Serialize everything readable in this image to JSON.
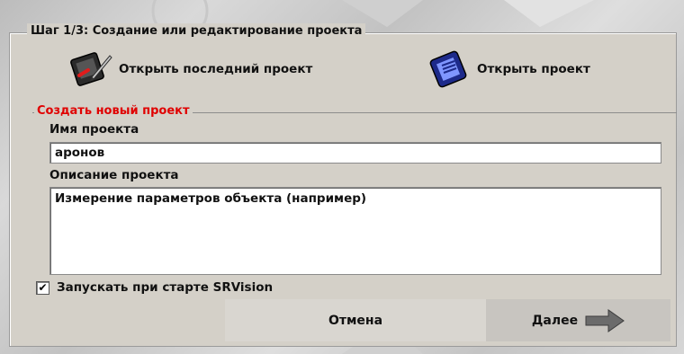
{
  "wizard": {
    "step_title": "Шаг 1/3: Создание или редактирование проекта"
  },
  "open_actions": {
    "open_last_label": "Открыть последний проект",
    "open_label": "Открыть проект"
  },
  "new_project": {
    "legend": "Создать новый проект",
    "name_label": "Имя проекта",
    "name_value": "аронов",
    "description_label": "Описание проекта",
    "description_value": "Измерение параметров объекта (например)"
  },
  "startup": {
    "checkbox_label": "Запускать при старте SRVision",
    "checked": true,
    "check_mark": "✔"
  },
  "footer": {
    "cancel_label": "Отмена",
    "next_label": "Далее"
  },
  "colors": {
    "accent_red": "#e00000",
    "panel": "#d4d0c8"
  },
  "icons": {
    "open_last": "pencil-book-icon",
    "open": "blue-document-icon",
    "next": "arrow-right-icon"
  }
}
